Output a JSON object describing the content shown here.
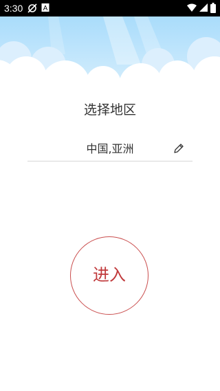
{
  "status_bar": {
    "time": "3:30",
    "icons_left": [
      "sync-off-icon",
      "font-a-icon"
    ],
    "icons_right": [
      "wifi-icon",
      "cellular-icon",
      "battery-icon"
    ]
  },
  "colors": {
    "sky": "#bfe4fb",
    "cloud": "#ffffff",
    "accent": "#c0393b",
    "divider": "#d6d6d6",
    "text": "#333333"
  },
  "page": {
    "title": "选择地区"
  },
  "region": {
    "value": "中国,亚洲",
    "edit_icon": "pencil-icon"
  },
  "enter_button": {
    "label": "进入"
  }
}
